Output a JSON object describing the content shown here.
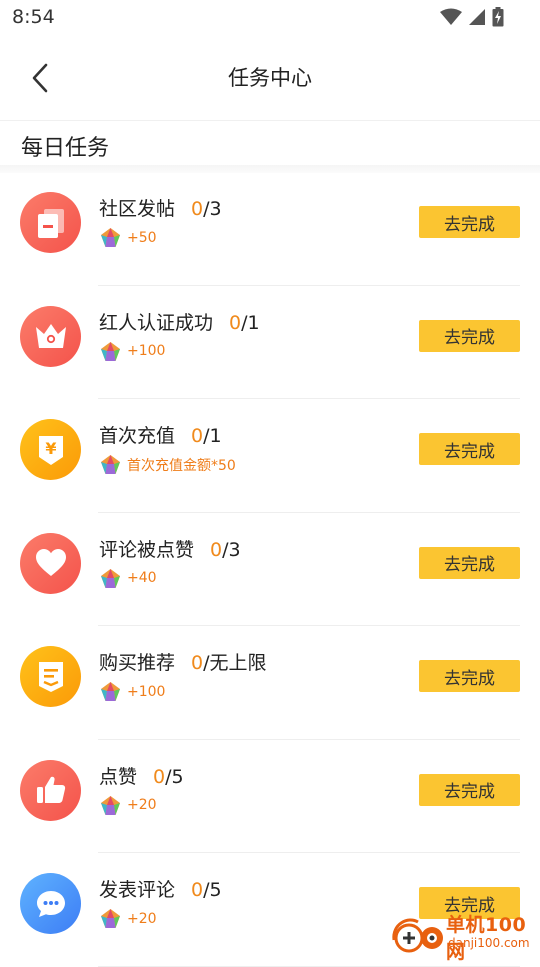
{
  "status_bar": {
    "time": "8:54",
    "icons": [
      "wifi-icon",
      "signal-icon",
      "battery-charging-icon"
    ]
  },
  "app_bar": {
    "title": "任务中心",
    "back_icon": "chevron-left-icon"
  },
  "section": {
    "title": "每日任务"
  },
  "colors": {
    "accent_orange": "#f08a1c",
    "button_yellow": "#fbc531",
    "icon_red": "#f7665c",
    "icon_orange": "#fca910",
    "icon_blue": "#4d94ff"
  },
  "tasks": [
    {
      "name": "社区发帖",
      "done": "0",
      "total": "/3",
      "reward": "+50",
      "button": "去完成",
      "icon": "posts-icon",
      "icon_color": "red"
    },
    {
      "name": "红人认证成功",
      "done": "0",
      "total": "/1",
      "reward": "+100",
      "button": "去完成",
      "icon": "crown-icon",
      "icon_color": "red"
    },
    {
      "name": "首次充值",
      "done": "0",
      "total": "/1",
      "reward": "首次充值金额*50",
      "button": "去完成",
      "icon": "yuan-icon",
      "icon_color": "orange"
    },
    {
      "name": "评论被点赞",
      "done": "0",
      "total": "/3",
      "reward": "+40",
      "button": "去完成",
      "icon": "heart-icon",
      "icon_color": "red"
    },
    {
      "name": "购买推荐",
      "done": "0",
      "total": "/无上限",
      "reward": "+100",
      "button": "去完成",
      "icon": "receipt-icon",
      "icon_color": "orange"
    },
    {
      "name": "点赞",
      "done": "0",
      "total": "/5",
      "reward": "+20",
      "button": "去完成",
      "icon": "thumbs-up-icon",
      "icon_color": "red"
    },
    {
      "name": "发表评论",
      "done": "0",
      "total": "/5",
      "reward": "+20",
      "button": "去完成",
      "icon": "chat-bubble-icon",
      "icon_color": "blue"
    }
  ],
  "watermark": {
    "name": "单机100网",
    "url": "danji100.com"
  }
}
